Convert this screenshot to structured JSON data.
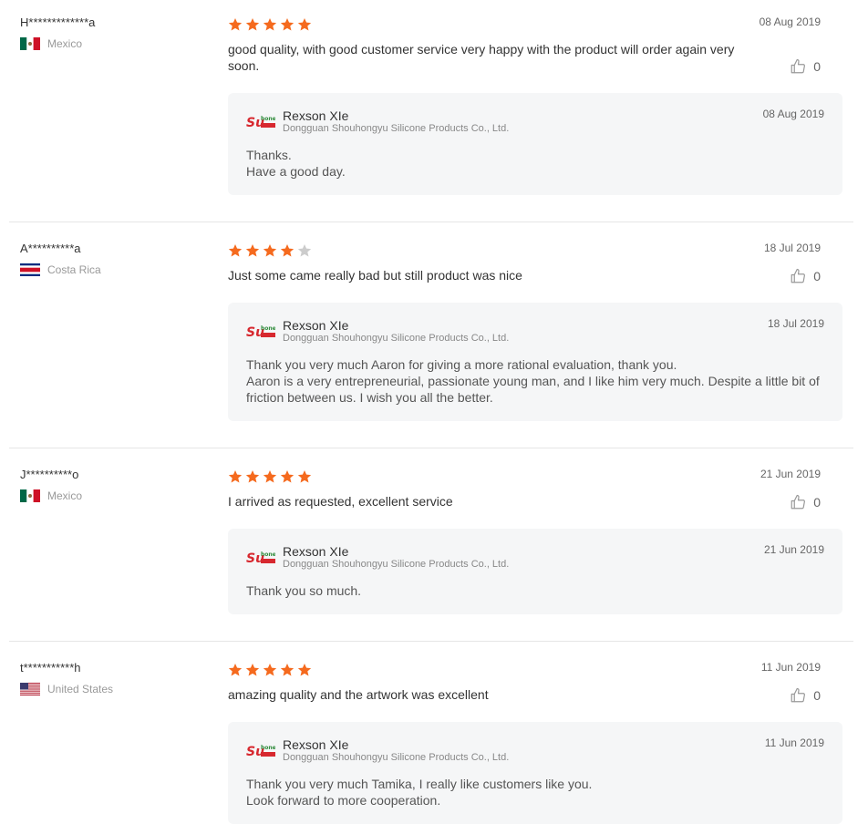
{
  "colors": {
    "star": "#f56a1e",
    "star_empty": "#cccccc",
    "reply_bg": "#f5f6f7"
  },
  "reviews": [
    {
      "buyer": "H*************a",
      "country": "Mexico",
      "flag": "mexico-flag-icon",
      "rating": 5,
      "date": "08 Aug 2019",
      "text": "good quality, with good customer service very happy with the product will order again very soon.",
      "likes": "0",
      "reply": {
        "name": "Rexson XIe",
        "company": "Dongguan Shouhongyu Silicone Products Co., Ltd.",
        "date": "08 Aug 2019",
        "lines": [
          "Thanks.",
          "Have a good day."
        ]
      }
    },
    {
      "buyer": "A**********a",
      "country": "Costa Rica",
      "flag": "costa-rica-flag-icon",
      "rating": 4,
      "date": "18 Jul 2019",
      "text": "Just some came really bad but still product was nice",
      "likes": "0",
      "reply": {
        "name": "Rexson XIe",
        "company": "Dongguan Shouhongyu Silicone Products Co., Ltd.",
        "date": "18 Jul 2019",
        "lines": [
          "Thank you very much Aaron for giving a more rational evaluation, thank you.",
          "Aaron is a very entrepreneurial, passionate young man, and I like him very much. Despite a little bit of friction between us. I wish you all the better."
        ]
      }
    },
    {
      "buyer": "J**********o",
      "country": "Mexico",
      "flag": "mexico-flag-icon",
      "rating": 5,
      "date": "21 Jun 2019",
      "text": "I arrived as requested, excellent service",
      "likes": "0",
      "reply": {
        "name": "Rexson XIe",
        "company": "Dongguan Shouhongyu Silicone Products Co., Ltd.",
        "date": "21 Jun 2019",
        "lines": [
          "Thank you so much."
        ]
      }
    },
    {
      "buyer": "t***********h",
      "country": "United States",
      "flag": "united-states-flag-icon",
      "rating": 5,
      "date": "11 Jun 2019",
      "text": "amazing quality and the artwork was excellent",
      "likes": "0",
      "reply": {
        "name": "Rexson XIe",
        "company": "Dongguan Shouhongyu Silicone Products Co., Ltd.",
        "date": "11 Jun 2019",
        "lines": [
          "Thank you very much Tamika, I really like customers like you.",
          "Look forward to more cooperation."
        ]
      }
    }
  ]
}
